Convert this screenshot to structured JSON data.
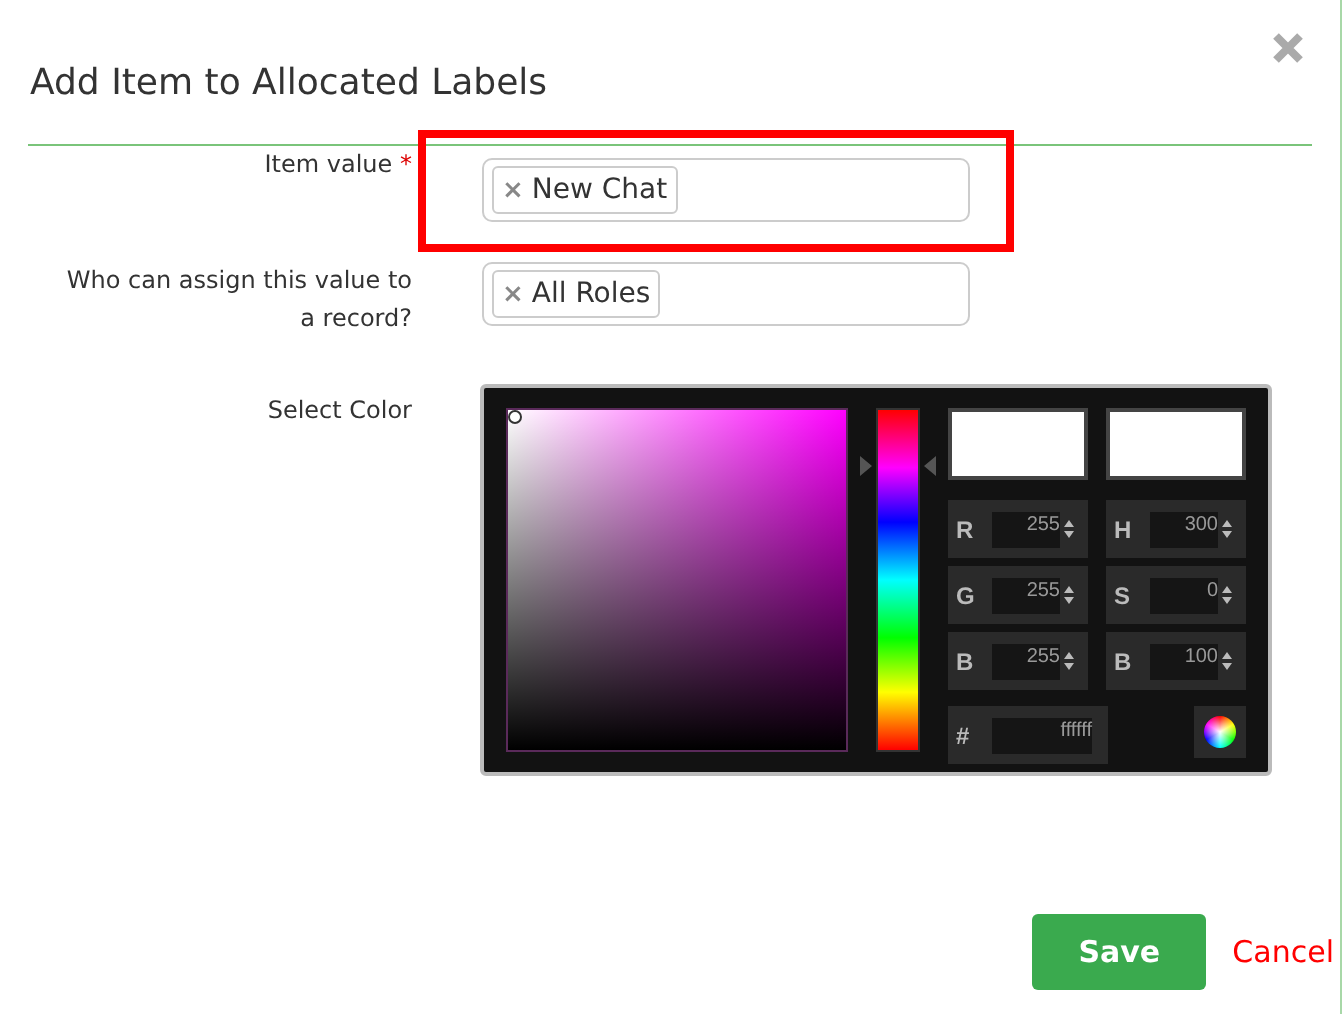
{
  "dialog": {
    "title": "Add Item to Allocated Labels"
  },
  "fields": [
    {
      "label": "Item value",
      "required": true,
      "required_mark": "*",
      "highlighted": true,
      "tags": [
        "New Chat"
      ],
      "remove_glyph": "×"
    },
    {
      "label": "Who can assign this value to a record?",
      "required": false,
      "highlighted": false,
      "tags": [
        "All Roles"
      ],
      "remove_glyph": "×"
    }
  ],
  "color_field": {
    "label": "Select Color",
    "rows": [
      {
        "left": {
          "label": "R",
          "value": "255"
        },
        "right": {
          "label": "H",
          "value": "300"
        }
      },
      {
        "left": {
          "label": "G",
          "value": "255"
        },
        "right": {
          "label": "S",
          "value": "0"
        }
      },
      {
        "left": {
          "label": "B",
          "value": "255"
        },
        "right": {
          "label": "B",
          "value": "100"
        }
      }
    ],
    "hex": {
      "label": "#",
      "value": "ffffff"
    }
  },
  "buttons": {
    "save": "Save",
    "cancel": "Cancel"
  }
}
